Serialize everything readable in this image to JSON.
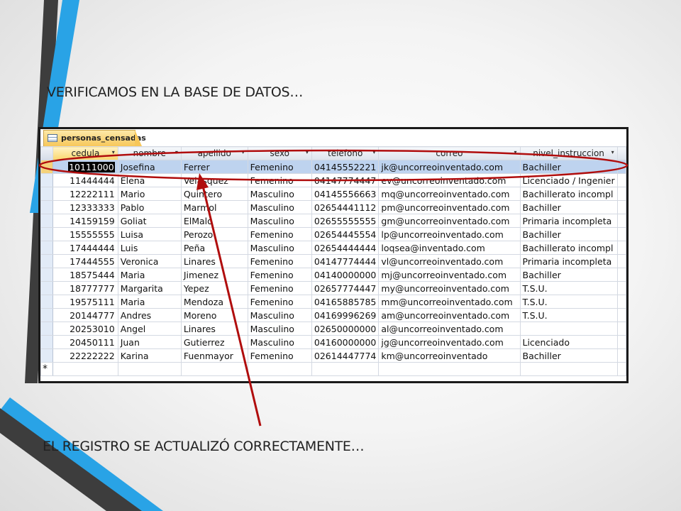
{
  "slide": {
    "heading_top": "VERIFICAMOS EN LA BASE DE DATOS…",
    "heading_bottom": "EL REGISTRO SE ACTUALIZÓ CORRECTAMENTE…"
  },
  "window": {
    "tab_title": "personas_censadas",
    "columns": [
      "cedula",
      "nombre",
      "apellido",
      "sexo",
      "telefono",
      "correo",
      "nivel_instruccion"
    ],
    "new_row_marker": "*",
    "rows": [
      [
        "10111000",
        "Josefina",
        "Ferrer",
        "Femenino",
        "04145552221",
        "jk@uncorreoinventado.com",
        "Bachiller"
      ],
      [
        "11444444",
        "Elena",
        "Velasquez",
        "Femenino",
        "04147774447",
        "ev@uncorreoinventado.com",
        "Licenciado / Ingenier"
      ],
      [
        "12222111",
        "Mario",
        "Quintero",
        "Masculino",
        "04145556663",
        "mq@uncorreoinventado.com",
        "Bachillerato incompl"
      ],
      [
        "12333333",
        "Pablo",
        "Marmol",
        "Masculino",
        "02654441112",
        "pm@uncorreoinventado.com",
        "Bachiller"
      ],
      [
        "14159159",
        "Goliat",
        "ElMalo",
        "Masculino",
        "02655555555",
        "gm@uncorreoinventado.com",
        "Primaria incompleta"
      ],
      [
        "15555555",
        "Luisa",
        "Perozo",
        "Femenino",
        "02654445554",
        "lp@uncorreoinventado.com",
        "Bachiller"
      ],
      [
        "17444444",
        "Luis",
        "Peña",
        "Masculino",
        "02654444444",
        "loqsea@inventado.com",
        "Bachillerato incompl"
      ],
      [
        "17444555",
        "Veronica",
        "Linares",
        "Femenino",
        "04147774444",
        "vl@uncorreoinventado.com",
        "Primaria incompleta"
      ],
      [
        "18575444",
        "Maria",
        "Jimenez",
        "Femenino",
        "04140000000",
        "mj@uncorreoinventado.com",
        "Bachiller"
      ],
      [
        "18777777",
        "Margarita",
        "Yepez",
        "Femenino",
        "02657774447",
        "my@uncorreoinventado.com",
        "T.S.U."
      ],
      [
        "19575111",
        "Maria",
        "Mendoza",
        "Femenino",
        "04165885785",
        "mm@uncorreoinventado.com",
        "T.S.U."
      ],
      [
        "20144777",
        "Andres",
        "Moreno",
        "Masculino",
        "04169996269",
        "am@uncorreoinventado.com",
        "T.S.U."
      ],
      [
        "20253010",
        "Angel",
        "Linares",
        "Masculino",
        "02650000000",
        "al@uncorreoinventado.com",
        ""
      ],
      [
        "20450111",
        "Juan",
        "Gutierrez",
        "Masculino",
        "04160000000",
        "jg@uncorreoinventado.com",
        "Licenciado"
      ],
      [
        "22222222",
        "Karina",
        "Fuenmayor",
        "Femenino",
        "02614447774",
        "km@uncorreoinventado",
        "Bachiller"
      ]
    ]
  },
  "colors": {
    "accent_blue": "#29a3e6",
    "dark_stripe": "#3d3d3d",
    "annotation_red": "#b00d0d",
    "selected_row": "#bed3ef"
  }
}
